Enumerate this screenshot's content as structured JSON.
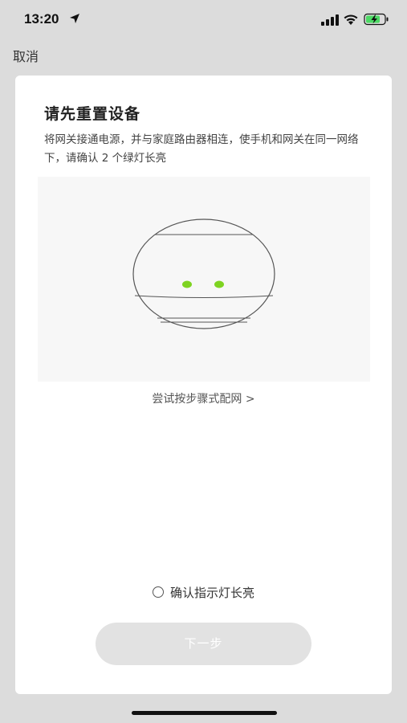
{
  "status_bar": {
    "time": "13:20",
    "icons": [
      "location-arrow-icon",
      "cellular-signal-icon",
      "wifi-icon",
      "battery-charging-icon"
    ]
  },
  "nav": {
    "cancel_label": "取消"
  },
  "card": {
    "title": "请先重置设备",
    "instruction": "将网关接通电源，并与家庭路由器相连，使手机和网关在同一网络下，请确认 2 个绿灯长亮",
    "illustration": {
      "led_color": "#7ed321",
      "led_count": 2
    },
    "alt_link_label": "尝试按步骤式配网 >",
    "confirm_label": "确认指示灯长亮",
    "confirm_checked": false,
    "next_button_label": "下一步",
    "next_button_enabled": false
  },
  "colors": {
    "background": "#dcdcdc",
    "card": "#ffffff",
    "led_green": "#7ed321",
    "button_disabled": "#e2e2e2",
    "battery_green": "#4cd964"
  }
}
